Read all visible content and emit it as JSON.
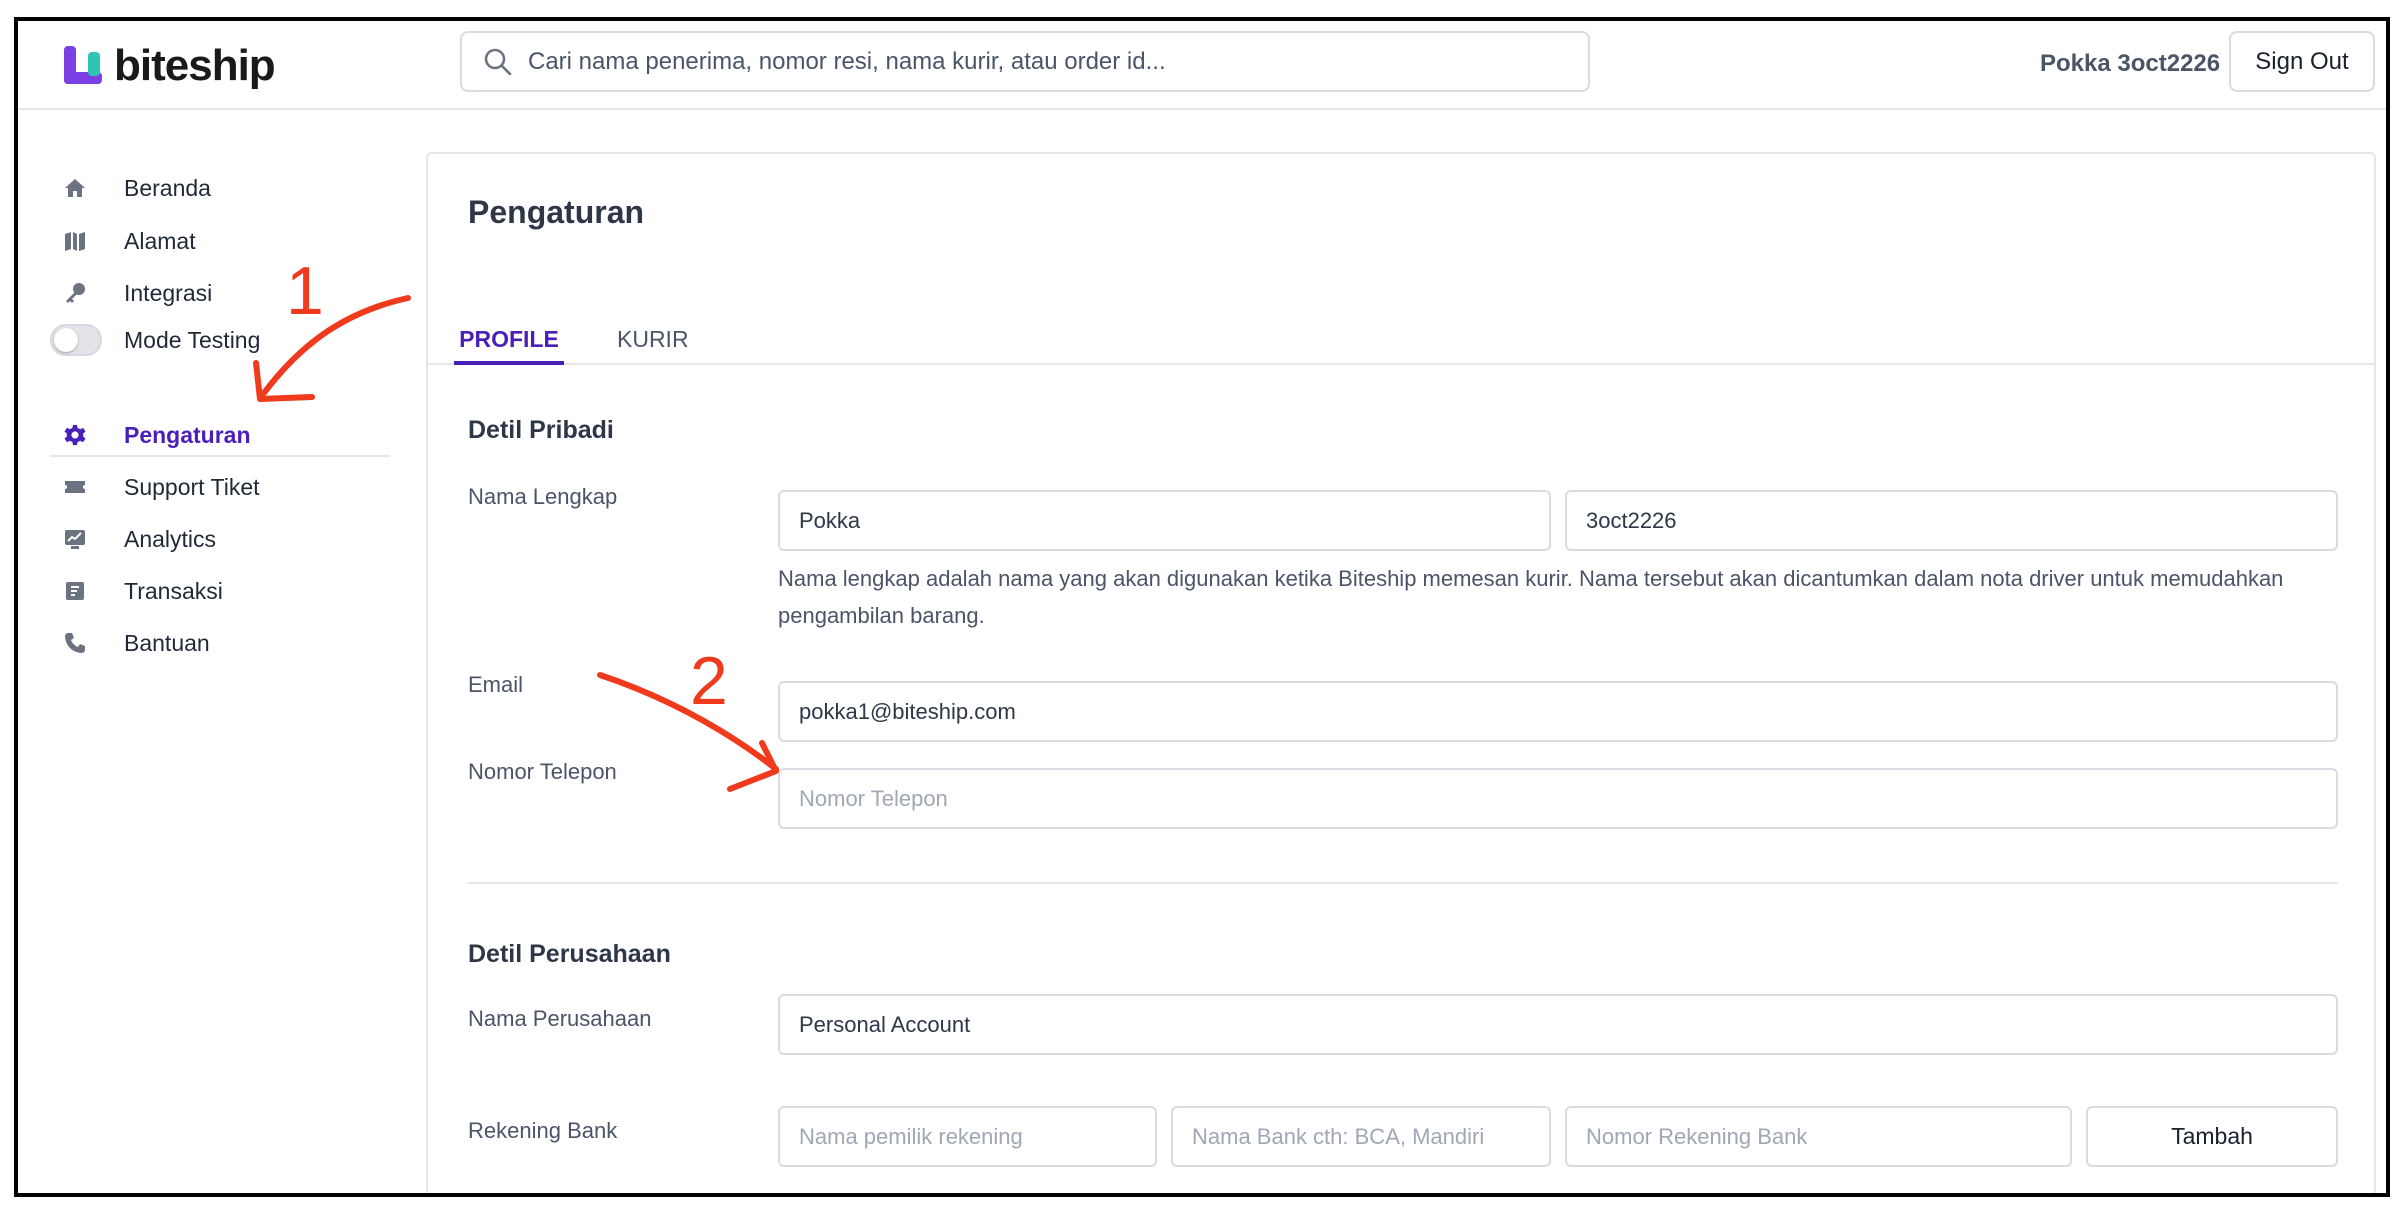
{
  "brand": {
    "name": "biteship",
    "accent": "#4a1fb8",
    "logo_colors": [
      "#7b3fe4",
      "#2ec4b6"
    ]
  },
  "header": {
    "search_placeholder": "Cari nama penerima, nomor resi, nama kurir, atau order id...",
    "user_name": "Pokka 3oct2226",
    "signout_label": "Sign Out"
  },
  "sidebar": {
    "items": [
      {
        "label": "Beranda",
        "icon": "home-icon"
      },
      {
        "label": "Alamat",
        "icon": "map-icon"
      },
      {
        "label": "Integrasi",
        "icon": "key-icon"
      },
      {
        "label": "Mode Testing",
        "icon": "toggle-switch",
        "toggle_on": false
      },
      {
        "label": "Pengaturan",
        "icon": "gear-icon",
        "active": true
      },
      {
        "label": "Support Tiket",
        "icon": "ticket-icon"
      },
      {
        "label": "Analytics",
        "icon": "chart-icon"
      },
      {
        "label": "Transaksi",
        "icon": "receipt-icon"
      },
      {
        "label": "Bantuan",
        "icon": "phone-icon"
      }
    ]
  },
  "main": {
    "title": "Pengaturan",
    "tabs": [
      {
        "label": "PROFILE",
        "active": true
      },
      {
        "label": "KURIR",
        "active": false
      }
    ],
    "personal": {
      "section_title": "Detil Pribadi",
      "name_label": "Nama Lengkap",
      "first_name": "Pokka",
      "last_name": "3oct2226",
      "helper": "Nama lengkap adalah nama yang akan digunakan ketika Biteship memesan kurir. Nama tersebut akan dicantumkan dalam nota driver untuk memudahkan pengambilan barang.",
      "email_label": "Email",
      "email_value": "pokka1@biteship.com",
      "phone_label": "Nomor Telepon",
      "phone_placeholder": "Nomor Telepon"
    },
    "company": {
      "section_title": "Detil Perusahaan",
      "company_label": "Nama Perusahaan",
      "company_value": "Personal Account",
      "bank_label": "Rekening Bank",
      "bank_owner_placeholder": "Nama pemilik rekening",
      "bank_name_placeholder": "Nama Bank cth: BCA, Mandiri",
      "bank_number_placeholder": "Nomor Rekening Bank",
      "add_label": "Tambah"
    }
  },
  "annotations": {
    "marker_1": "1",
    "marker_2": "2",
    "color": "#f03a1e"
  }
}
